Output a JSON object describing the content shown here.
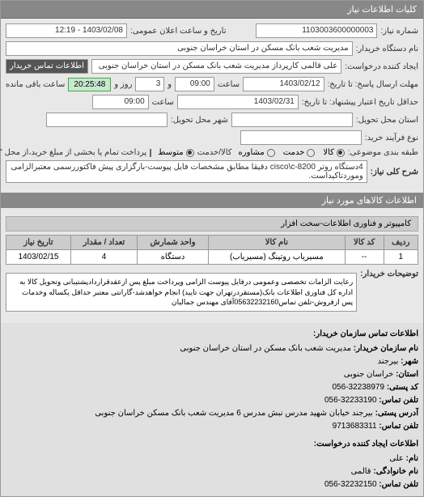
{
  "header": "کلیات اطلاعات نیاز",
  "rows": {
    "request_no_label": "شماره نیاز:",
    "request_no": "1103003600000003",
    "announce_label": "تاریخ و ساعت اعلان عمومی:",
    "announce_value": "1403/02/08 - 12:19",
    "device_name_label": "نام دستگاه خریدار:",
    "device_name": "مدیریت شعب بانک مسکن در استان خراسان جنوبی",
    "creator_label": "ایجاد کننده درخواست:",
    "creator": "علی قالمی کارپرداز مدیریت شعب بانک مسکن در استان خراسان جنوبی",
    "contact_btn": "اطلاعات تماس خریدار",
    "deadline_send_label": "مهلت ارسال پاسخ: تا تاریخ:",
    "deadline_recv_label": "حداقل تاریخ اعتبار پیشنهاد: تا تاریخ:",
    "deadline_date1": "1403/02/12",
    "deadline_time1": "09:00",
    "days_label": "و",
    "days_val": "3",
    "days_suffix": "روز و",
    "remain_time": "20:25:48",
    "remain_suffix": "ساعت باقی مانده",
    "deadline_date2": "1403/02/31",
    "deadline_time2": "09:00",
    "province_label": "استان محل تحویل:",
    "city_label": "شهر محل تحویل:",
    "process_label": "نوع فرآیند خرید:",
    "budget_label": "طبقه بندی موضوعی:",
    "cat1": "کالا",
    "cat2": "خدمت",
    "cat3": "مشاوره",
    "scale_label": "کالا/خدمت",
    "scale1": "متوسط",
    "pay_note": "پرداخت تمام یا بخشی از مبلغ خرید،از محل \"اسناد خزانه اسلامی\" خواهد بود.",
    "key_label": "شرح کلی نیاز:",
    "key_value": "4دستگاه روتر cisco\\c-8200 دقیقا مطابق مشخصات فایل پیوست-بارگزاری پیش فاکتوررسمی معتبرالزامی وموردتاکیداست."
  },
  "goods_header": "اطلاعات کالاهای مورد نیاز",
  "goods_sub": "کامپیوتر و فناوری اطلاعات-سخت افزار",
  "table": {
    "headers": [
      "ردیف",
      "کد کالا",
      "نام کالا",
      "واحد شمارش",
      "تعداد / مقدار",
      "تاریخ نیاز"
    ],
    "row": [
      "1",
      "--",
      "مسیریاب روتینگ (مسیریاب)",
      "دستگاه",
      "4",
      "1403/02/15"
    ]
  },
  "buyer_note_label": "توضیحات خریدار:",
  "buyer_note": "رعایت الزامات تخصصی وعمومی درفایل پیوست الزامی وپرداخت مبلغ پس ازعقدقراردادپشتیبانی وتحویل کالا به اداره کل فناوری اطلاعات بانک(مستقردرتهران جهت تایید) انجام خواهدشد-گارانتی معتبر حداقل یکساله وخدمات پس ازفروش-تلفن تماس05632232160آقای مهندس جمالیان",
  "org_contact_header": "اطلاعات تماس سازمان خریدار:",
  "org_contact": {
    "name_label": "نام سازمان خریدار:",
    "name": "مدیریت شعب بانک مسکن در استان خراسان جنوبی",
    "city_label": "شهر:",
    "city": "بیرجند",
    "province_label": "استان:",
    "province": "خراسان جنوبی",
    "postal_label": "کد پستی:",
    "postal": "32238979-056",
    "phone_label": "تلفن تماس:",
    "phone": "32233190-056",
    "address_label": "آدرس پستی:",
    "address": "بیرجند خیابان شهید مدرس نبش مدرس 6 مدیریت شعب بانک مسکن خراسان جنوبی",
    "fax_label": "تلفن تماس:",
    "fax": "9713683311"
  },
  "req_creator_header": "اطلاعات ایجاد کننده درخواست:",
  "req_creator": {
    "name_label": "نام:",
    "name": "علی",
    "family_label": "نام خانوادگی:",
    "family": "قالمی",
    "phone_label": "تلفن تماس:",
    "phone": "32232150-056"
  }
}
